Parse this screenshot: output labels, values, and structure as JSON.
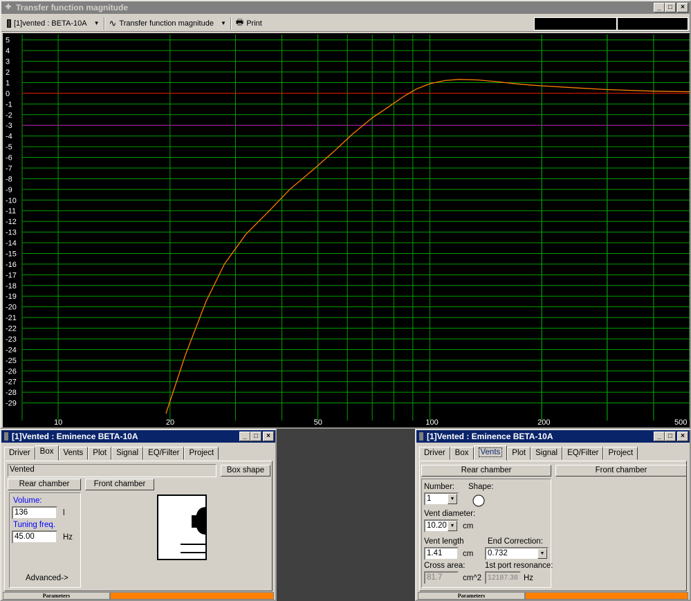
{
  "main_window": {
    "title": "Transfer function magnitude",
    "driver_select": "[1]vented : BETA-10A",
    "plot_select": "Transfer function magnitude",
    "print_label": "Print"
  },
  "chart_data": {
    "type": "line",
    "x_scale": "log",
    "xlim": [
      8,
      500
    ],
    "ylim": [
      -30,
      5.5
    ],
    "x_tick_labels": [
      "10",
      "20",
      "50",
      "100",
      "200",
      "500"
    ],
    "x_ticks": [
      10,
      20,
      50,
      100,
      200,
      500
    ],
    "y_ticks": [
      5,
      4,
      3,
      2,
      1,
      0,
      -1,
      -2,
      -3,
      -4,
      -5,
      -6,
      -7,
      -8,
      -9,
      -10,
      -11,
      -12,
      -13,
      -14,
      -15,
      -16,
      -17,
      -18,
      -19,
      -20,
      -21,
      -22,
      -23,
      -24,
      -25,
      -26,
      -27,
      -28,
      -29
    ],
    "y_tick_labels": [
      "5",
      "4",
      "3",
      "2",
      "1",
      "0",
      "-1",
      "-2",
      "-3",
      "-4",
      "-5",
      "-6",
      "-7",
      "-8",
      "-9",
      "-10",
      "-11",
      "-12",
      "-13",
      "-14",
      "-15",
      "-16",
      "-17",
      "-18",
      "-19",
      "-20",
      "-21",
      "-22",
      "-23",
      "-24",
      "-25",
      "-26",
      "-27",
      "-28",
      "-29"
    ],
    "reference_lines": [
      {
        "y": 0,
        "color": "#ff0000"
      },
      {
        "y": -3,
        "color": "#c000c0"
      }
    ],
    "grid": true,
    "grid_color": "#00a000",
    "series": [
      {
        "color": "#ff8000",
        "points": [
          [
            19.5,
            -30
          ],
          [
            22,
            -24.5
          ],
          [
            25,
            -19.5
          ],
          [
            28,
            -16
          ],
          [
            32,
            -13.2
          ],
          [
            37,
            -11
          ],
          [
            42,
            -9
          ],
          [
            48,
            -7.3
          ],
          [
            55,
            -5.5
          ],
          [
            62,
            -3.8
          ],
          [
            70,
            -2.3
          ],
          [
            78,
            -1.2
          ],
          [
            85,
            -0.3
          ],
          [
            92,
            0.4
          ],
          [
            100,
            0.9
          ],
          [
            110,
            1.2
          ],
          [
            120,
            1.3
          ],
          [
            135,
            1.25
          ],
          [
            150,
            1.1
          ],
          [
            175,
            0.85
          ],
          [
            200,
            0.7
          ],
          [
            250,
            0.5
          ],
          [
            300,
            0.35
          ],
          [
            400,
            0.2
          ],
          [
            500,
            0.15
          ]
        ]
      }
    ]
  },
  "box_window": {
    "title": "[1]Vented : Eminence BETA-10A",
    "tabs": [
      "Driver",
      "Box",
      "Vents",
      "Plot",
      "Signal",
      "EQ/Filter",
      "Project"
    ],
    "type_value": "Vented",
    "box_shape_label": "Box shape",
    "rear_chamber_label": "Rear chamber",
    "front_chamber_label": "Front chamber",
    "volume_label": "Volume:",
    "volume_value": "136",
    "volume_unit": "l",
    "tuning_label": "Tuning freq.",
    "tuning_value": "45.00",
    "tuning_unit": "Hz",
    "advanced_label": "Advanced->",
    "status_label": "Parameters"
  },
  "vents_window": {
    "title": "[1]Vented : Eminence BETA-10A",
    "tabs": [
      "Driver",
      "Box",
      "Vents",
      "Plot",
      "Signal",
      "EQ/Filter",
      "Project"
    ],
    "rear_chamber_label": "Rear chamber",
    "front_chamber_label": "Front chamber",
    "number_label": "Number:",
    "number_value": "1",
    "shape_label": "Shape:",
    "diameter_label": "Vent diameter:",
    "diameter_value": "10.20",
    "diameter_unit": "cm",
    "length_label": "Vent length",
    "length_value": "1.41",
    "length_unit": "cm",
    "end_correction_label": "End Correction:",
    "end_correction_value": "0.732",
    "cross_area_label": "Cross area:",
    "cross_area_value": "81.7",
    "cross_area_unit": "cm^2",
    "port_resonance_label": "1st port resonance:",
    "port_resonance_value": "12187.38",
    "port_resonance_unit": "Hz",
    "status_label": "Parameters"
  }
}
